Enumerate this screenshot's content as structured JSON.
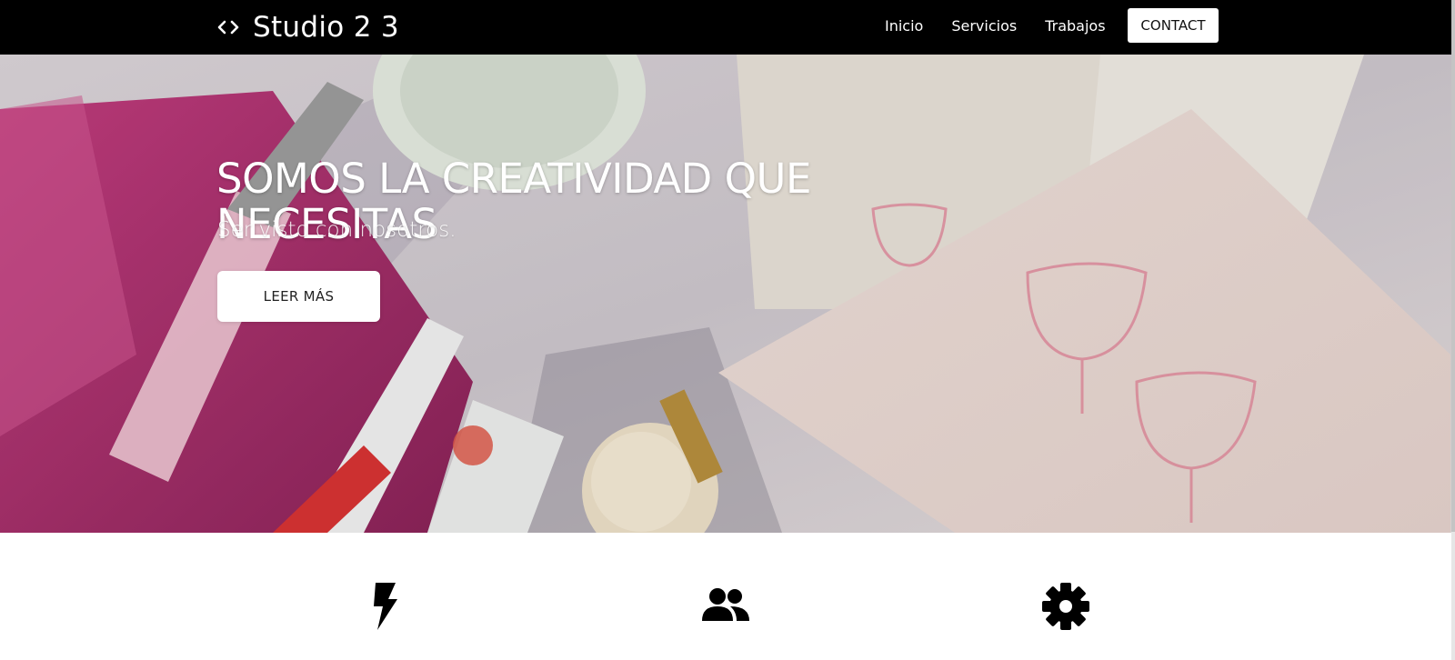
{
  "navbar": {
    "brand": {
      "icon": "code-brackets-icon",
      "title": "Studio 2 3"
    },
    "links": [
      {
        "label": "Inicio"
      },
      {
        "label": "Servicios"
      },
      {
        "label": "Trabajos"
      }
    ],
    "contact_label": "CONTACT"
  },
  "hero": {
    "background": "cosmetics-flatlay-photo",
    "title": "SOMOS LA CREATIVIDAD QUE NECESITAS",
    "subtitle": "Ser visto con nosotros.",
    "button_label": "LEER MÁS"
  },
  "features": {
    "icons": [
      "lightning-bolt-icon",
      "people-group-icon",
      "gear-icon"
    ]
  },
  "colors": {
    "navbar_bg": "#000000",
    "text_light": "#ffffff",
    "page_bg": "#ffffff"
  }
}
